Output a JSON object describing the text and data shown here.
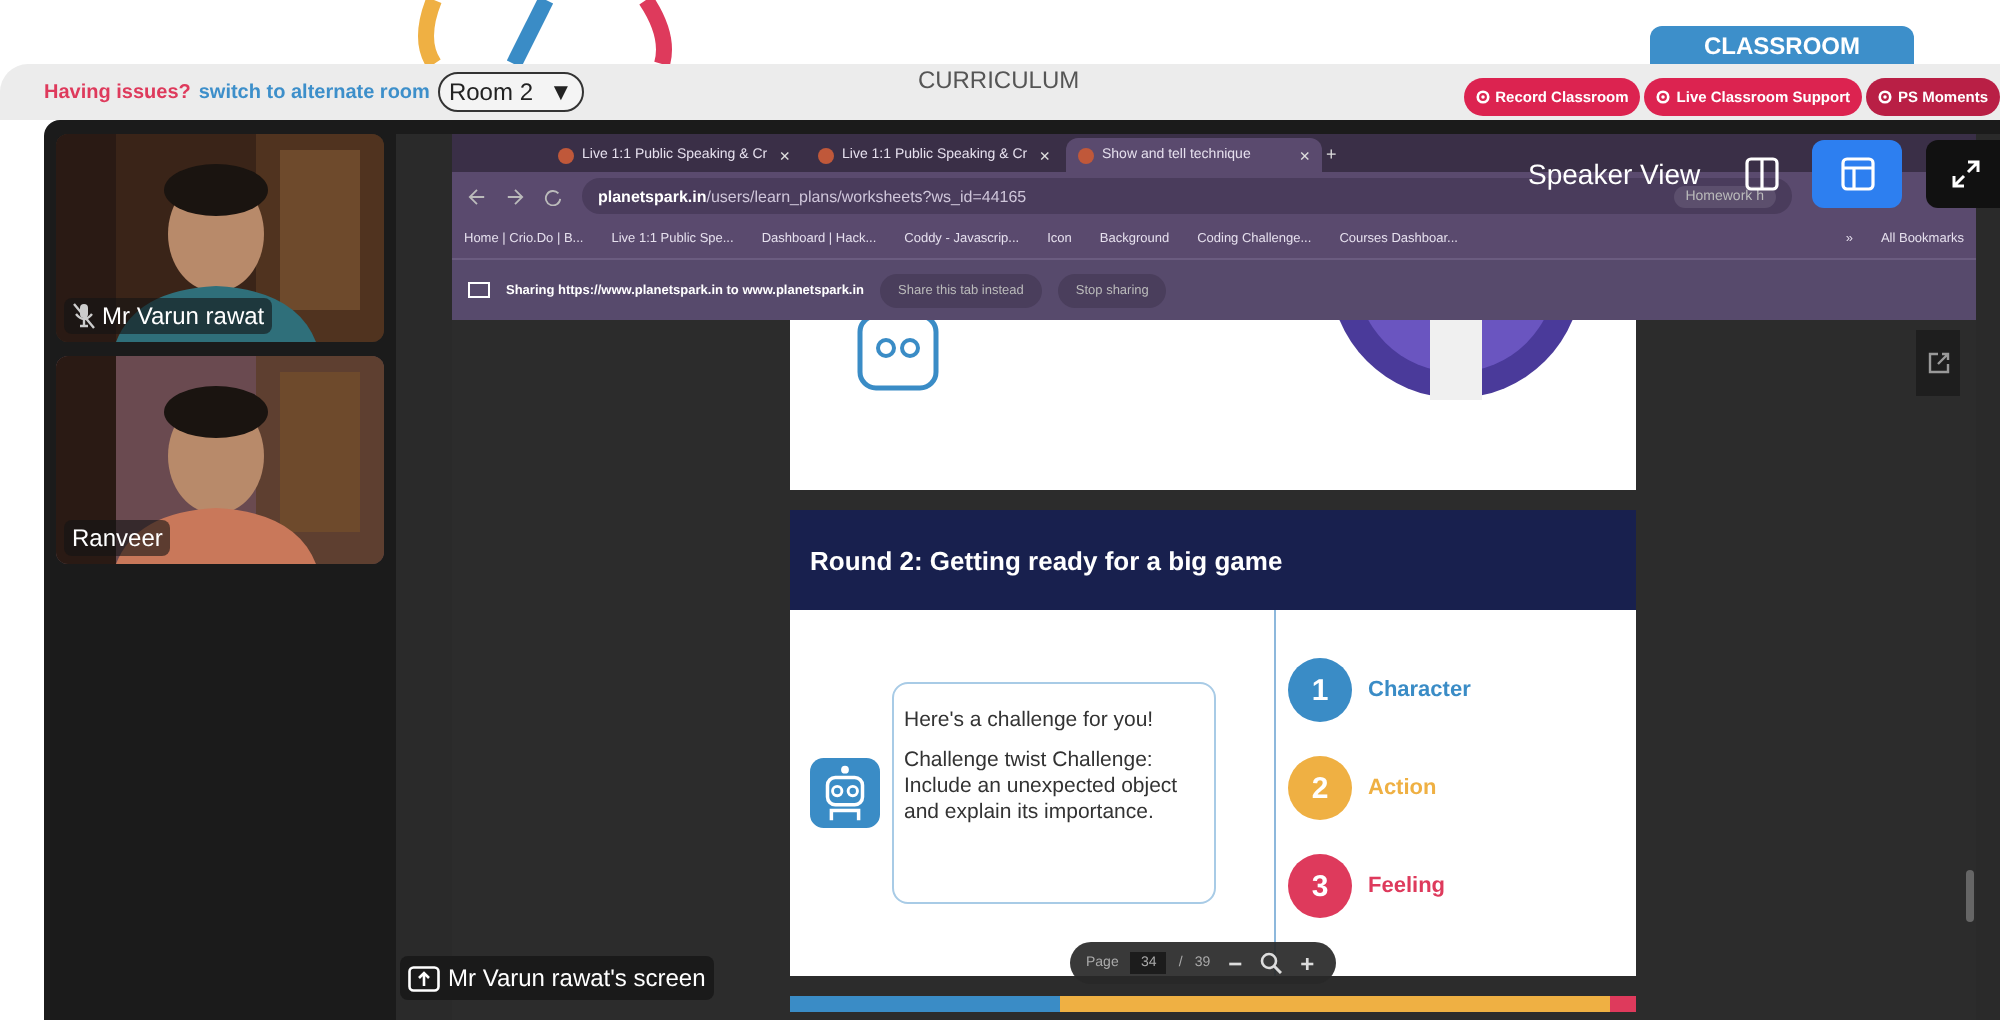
{
  "classroom_tab": {
    "label": "CLASSROOM"
  },
  "notice": {
    "question": "Having issues?",
    "link": "switch to alternate room"
  },
  "room_select": {
    "value": "Room 2",
    "caret": "▼"
  },
  "curriculum": "CURRICULUM",
  "actions": [
    "Record Classroom",
    "Live Classroom Support",
    "PS Moments"
  ],
  "participants": [
    {
      "name": "Mr Varun rawat",
      "muted": true
    },
    {
      "name": "Ranveer",
      "muted": false
    }
  ],
  "view_controls": {
    "label": "Speaker View",
    "modes": [
      {
        "kind": "split",
        "selected": false
      },
      {
        "kind": "speaker",
        "selected": true
      }
    ]
  },
  "shared_screen": {
    "label": "Mr Varun rawat's screen",
    "browser": {
      "tabs": [
        {
          "label": "Live 1:1 Public Speaking & Cr",
          "selected": false
        },
        {
          "label": "Live 1:1 Public Speaking & Cr",
          "selected": false
        },
        {
          "label": "Show and tell technique",
          "selected": true
        }
      ],
      "close_mark": "×",
      "new_tab": "+",
      "url": "**planetspark.in**/users/learn_plans/worksheets?ws_id=44165",
      "profile_chip": "Homework h",
      "bookmarks": [
        "Home | Crio.Do | B...",
        "Live 1:1 Public Spe...",
        "Dashboard | Hack...",
        "Coddy - Javascrip...",
        "Icon",
        "Background",
        "Coding Challenge...",
        "Courses Dashboar..."
      ],
      "more": "»",
      "all_bookmarks": "All Bookmarks",
      "sharing_text": "Sharing https://www.planetspark.in to www.planetspark.in",
      "sharing_buttons": [
        "Share this tab instead",
        "Stop sharing"
      ]
    },
    "slide": {
      "title": "Round 2: Getting ready for a big game",
      "bubble": [
        "Here's a challenge for you!",
        "Challenge twist Challenge: Include an unexpected object and explain its importance."
      ],
      "items": [
        {
          "number": "1",
          "label": "Character",
          "color": "#3a8cc6"
        },
        {
          "number": "2",
          "label": "Action",
          "color": "#efb043"
        },
        {
          "number": "3",
          "label": "Feeling",
          "color": "#de3a5c"
        }
      ]
    },
    "page_toolbar": {
      "label": "Page",
      "current": "34",
      "separator": "/",
      "total": "39",
      "zoom_out": "−",
      "zoom_in": "+"
    }
  }
}
